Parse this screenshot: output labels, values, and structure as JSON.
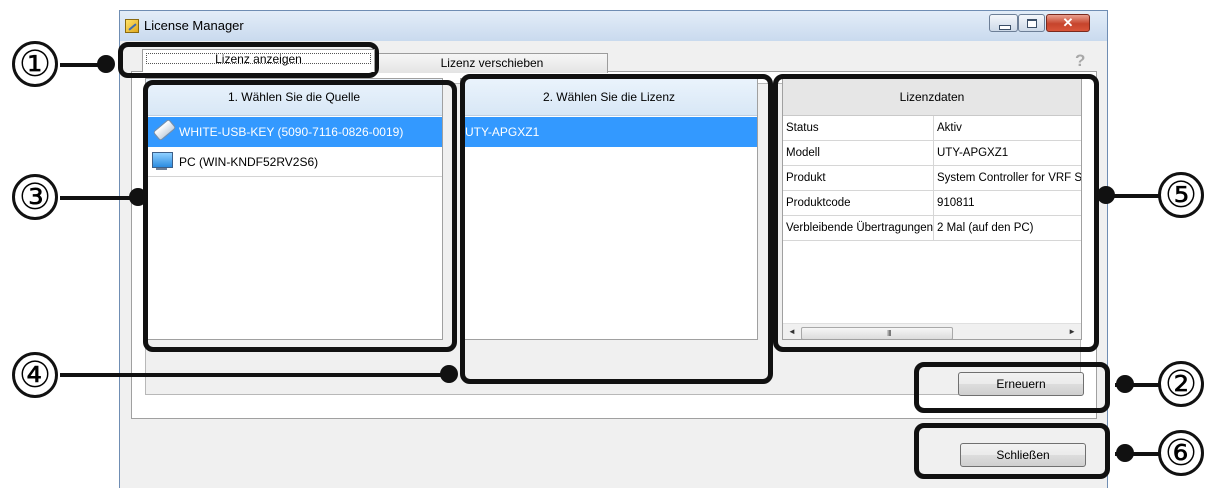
{
  "window": {
    "title": "License Manager"
  },
  "tabs": [
    {
      "label": "Lizenz anzeigen",
      "active": true
    },
    {
      "label": "Lizenz verschieben",
      "active": false
    }
  ],
  "help_icon": "?",
  "source_list": {
    "header": "1. Wählen Sie die Quelle",
    "items": [
      {
        "label": "WHITE-USB-KEY (5090-7116-0826-0019)",
        "icon": "usb-key-icon",
        "selected": true
      },
      {
        "label": "PC (WIN-KNDF52RV2S6)",
        "icon": "pc-monitor-icon",
        "selected": false
      }
    ]
  },
  "license_list": {
    "header": "2. Wählen Sie die Lizenz",
    "items": [
      {
        "label": "UTY-APGXZ1",
        "selected": true
      }
    ]
  },
  "license_data": {
    "header": "Lizenzdaten",
    "rows": [
      {
        "key": "Status",
        "value": "Aktiv"
      },
      {
        "key": "Modell",
        "value": "UTY-APGXZ1"
      },
      {
        "key": "Produkt",
        "value": "System Controller for VRF Sy"
      },
      {
        "key": "Produktcode",
        "value": "910811"
      },
      {
        "key": "Verbleibende Übertragungen",
        "value": "2 Mal (auf den PC)"
      }
    ],
    "scroll_grip": "III"
  },
  "buttons": {
    "renew": "Erneuern",
    "close": "Schließen"
  },
  "callouts": [
    "①",
    "②",
    "③",
    "④",
    "⑤",
    "⑥"
  ],
  "colors": {
    "selection": "#3399ff",
    "header_blue": "#dde9f6",
    "callout": "#111111"
  }
}
